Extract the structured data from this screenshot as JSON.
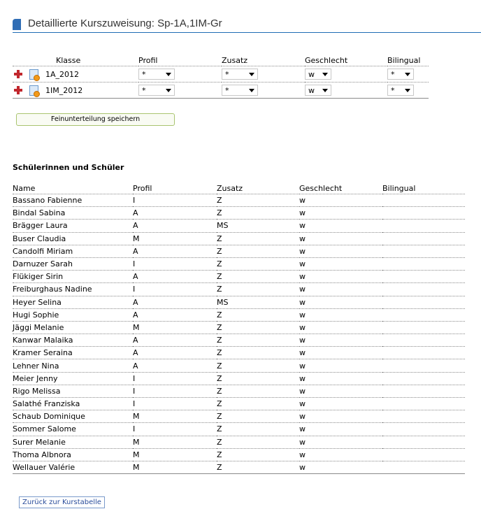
{
  "page": {
    "title": "Detaillierte Kurszuweisung: Sp-1A,1IM-Gr"
  },
  "class_table": {
    "headers": {
      "klasse": "Klasse",
      "profil": "Profil",
      "zusatz": "Zusatz",
      "geschlecht": "Geschlecht",
      "bilingual": "Bilingual"
    },
    "rows": [
      {
        "klasse": "1A_2012",
        "profil": "*",
        "zusatz": "*",
        "geschlecht": "w",
        "bilingual": "*"
      },
      {
        "klasse": "1IM_2012",
        "profil": "*",
        "zusatz": "*",
        "geschlecht": "w",
        "bilingual": "*"
      }
    ],
    "icons": {
      "add": "plus-icon",
      "details": "document-icon"
    }
  },
  "save_button": {
    "label": "Feinunterteilung speichern"
  },
  "students": {
    "heading": "Schülerinnen und Schüler",
    "headers": {
      "name": "Name",
      "profil": "Profil",
      "zusatz": "Zusatz",
      "geschlecht": "Geschlecht",
      "bilingual": "Bilingual"
    },
    "rows": [
      {
        "name": "Bassano Fabienne",
        "profil": "I",
        "zusatz": "Z",
        "geschlecht": "w",
        "bilingual": ""
      },
      {
        "name": "Bindal Sabina",
        "profil": "A",
        "zusatz": "Z",
        "geschlecht": "w",
        "bilingual": ""
      },
      {
        "name": "Brägger Laura",
        "profil": "A",
        "zusatz": "MS",
        "geschlecht": "w",
        "bilingual": ""
      },
      {
        "name": "Buser Claudia",
        "profil": "M",
        "zusatz": "Z",
        "geschlecht": "w",
        "bilingual": ""
      },
      {
        "name": "Candolfi Miriam",
        "profil": "A",
        "zusatz": "Z",
        "geschlecht": "w",
        "bilingual": ""
      },
      {
        "name": "Darnuzer Sarah",
        "profil": "I",
        "zusatz": "Z",
        "geschlecht": "w",
        "bilingual": ""
      },
      {
        "name": "Flükiger Sirin",
        "profil": "A",
        "zusatz": "Z",
        "geschlecht": "w",
        "bilingual": ""
      },
      {
        "name": "Freiburghaus Nadine",
        "profil": "I",
        "zusatz": "Z",
        "geschlecht": "w",
        "bilingual": ""
      },
      {
        "name": "Heyer Selina",
        "profil": "A",
        "zusatz": "MS",
        "geschlecht": "w",
        "bilingual": ""
      },
      {
        "name": "Hugi Sophie",
        "profil": "A",
        "zusatz": "Z",
        "geschlecht": "w",
        "bilingual": ""
      },
      {
        "name": "Jäggi Melanie",
        "profil": "M",
        "zusatz": "Z",
        "geschlecht": "w",
        "bilingual": ""
      },
      {
        "name": "Kanwar Malaika",
        "profil": "A",
        "zusatz": "Z",
        "geschlecht": "w",
        "bilingual": ""
      },
      {
        "name": "Kramer Seraina",
        "profil": "A",
        "zusatz": "Z",
        "geschlecht": "w",
        "bilingual": ""
      },
      {
        "name": "Lehner Nina",
        "profil": "A",
        "zusatz": "Z",
        "geschlecht": "w",
        "bilingual": ""
      },
      {
        "name": "Meier Jenny",
        "profil": "I",
        "zusatz": "Z",
        "geschlecht": "w",
        "bilingual": ""
      },
      {
        "name": "Rigo Melissa",
        "profil": "I",
        "zusatz": "Z",
        "geschlecht": "w",
        "bilingual": ""
      },
      {
        "name": "Salathé Franziska",
        "profil": "I",
        "zusatz": "Z",
        "geschlecht": "w",
        "bilingual": ""
      },
      {
        "name": "Schaub Dominique",
        "profil": "M",
        "zusatz": "Z",
        "geschlecht": "w",
        "bilingual": ""
      },
      {
        "name": "Sommer Salome",
        "profil": "I",
        "zusatz": "Z",
        "geschlecht": "w",
        "bilingual": ""
      },
      {
        "name": "Surer Melanie",
        "profil": "M",
        "zusatz": "Z",
        "geschlecht": "w",
        "bilingual": ""
      },
      {
        "name": "Thoma Albnora",
        "profil": "M",
        "zusatz": "Z",
        "geschlecht": "w",
        "bilingual": ""
      },
      {
        "name": "Wellauer Valérie",
        "profil": "M",
        "zusatz": "Z",
        "geschlecht": "w",
        "bilingual": ""
      }
    ]
  },
  "back_link": {
    "label": "Zurück zur Kurstabelle"
  }
}
